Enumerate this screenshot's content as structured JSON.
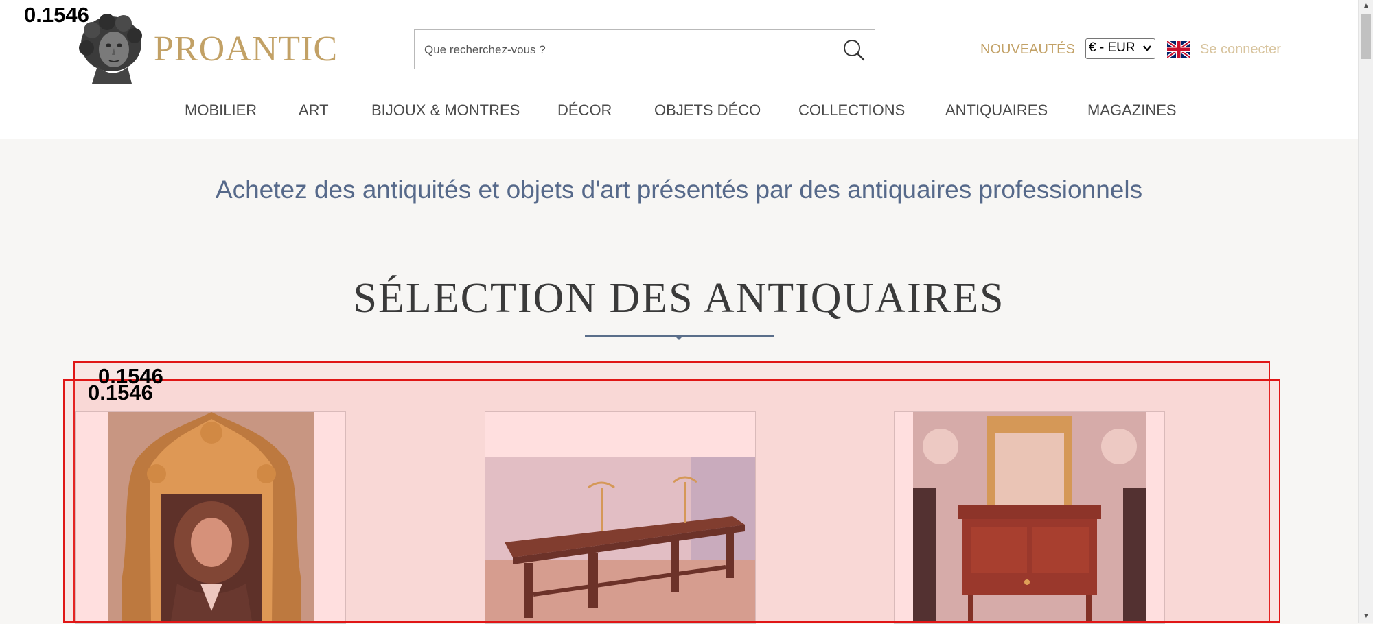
{
  "header": {
    "brand": "PROANTIC",
    "search_placeholder": "Que recherchez-vous ?",
    "nouveautes": "NOUVEAUTÉS",
    "currency": "€ - EUR",
    "login": "Se connecter"
  },
  "nav": [
    {
      "label": "MOBILIER"
    },
    {
      "label": "ART"
    },
    {
      "label": "BIJOUX & MONTRES"
    },
    {
      "label": "DÉCOR"
    },
    {
      "label": "OBJETS DÉCO"
    },
    {
      "label": "COLLECTIONS"
    },
    {
      "label": "ANTIQUAIRES"
    },
    {
      "label": "MAGAZINES"
    }
  ],
  "main": {
    "tagline": "Achetez des antiquités et objets d'art présentés par des antiquaires professionnels",
    "section_title": "SÉLECTION DES ANTIQUAIRES"
  },
  "overlay_labels": {
    "logo_score": "0.1546",
    "box1_score": "0.1546",
    "box2_score": "0.1546"
  },
  "colors": {
    "brand": "#c2a166",
    "accent_blue": "#56698a",
    "highlight": "#e01616"
  }
}
